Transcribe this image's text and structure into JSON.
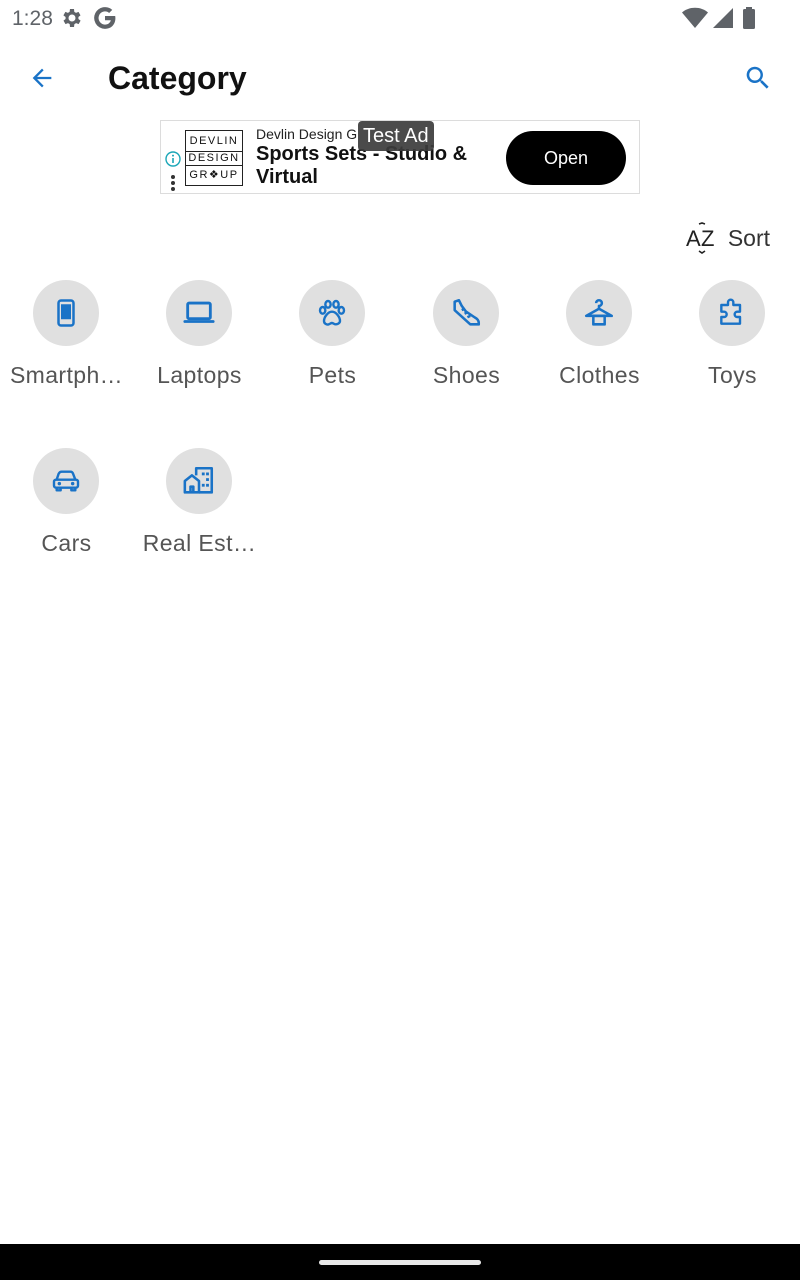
{
  "status_bar": {
    "time": "1:28",
    "icons": [
      "gear-icon",
      "google-g-icon",
      "wifi-icon",
      "cell-signal-icon",
      "battery-icon"
    ]
  },
  "app_bar": {
    "title": "Category",
    "back_icon": "arrow-back-icon",
    "search_icon": "search-icon"
  },
  "ad": {
    "badge": "Test Ad",
    "advertiser": "Devlin Design G",
    "headline": "Sports Sets - Studio & Virtual",
    "cta": "Open",
    "logo_lines": [
      "DEVLIN",
      "DESIGN",
      "GR❖UP"
    ]
  },
  "sort": {
    "label": "Sort",
    "icon": "sort-az-icon"
  },
  "categories": [
    {
      "label": "Smartph…",
      "icon": "smartphone-icon"
    },
    {
      "label": "Laptops",
      "icon": "laptop-icon"
    },
    {
      "label": "Pets",
      "icon": "paw-icon"
    },
    {
      "label": "Shoes",
      "icon": "shoe-icon"
    },
    {
      "label": "Clothes",
      "icon": "hanger-icon"
    },
    {
      "label": "Toys",
      "icon": "puzzle-icon"
    },
    {
      "label": "Cars",
      "icon": "car-icon"
    },
    {
      "label": "Real Est…",
      "icon": "building-icon"
    }
  ],
  "colors": {
    "accent": "#1a73c7",
    "circle_bg": "#e0e0e0",
    "label_text": "#555555"
  }
}
